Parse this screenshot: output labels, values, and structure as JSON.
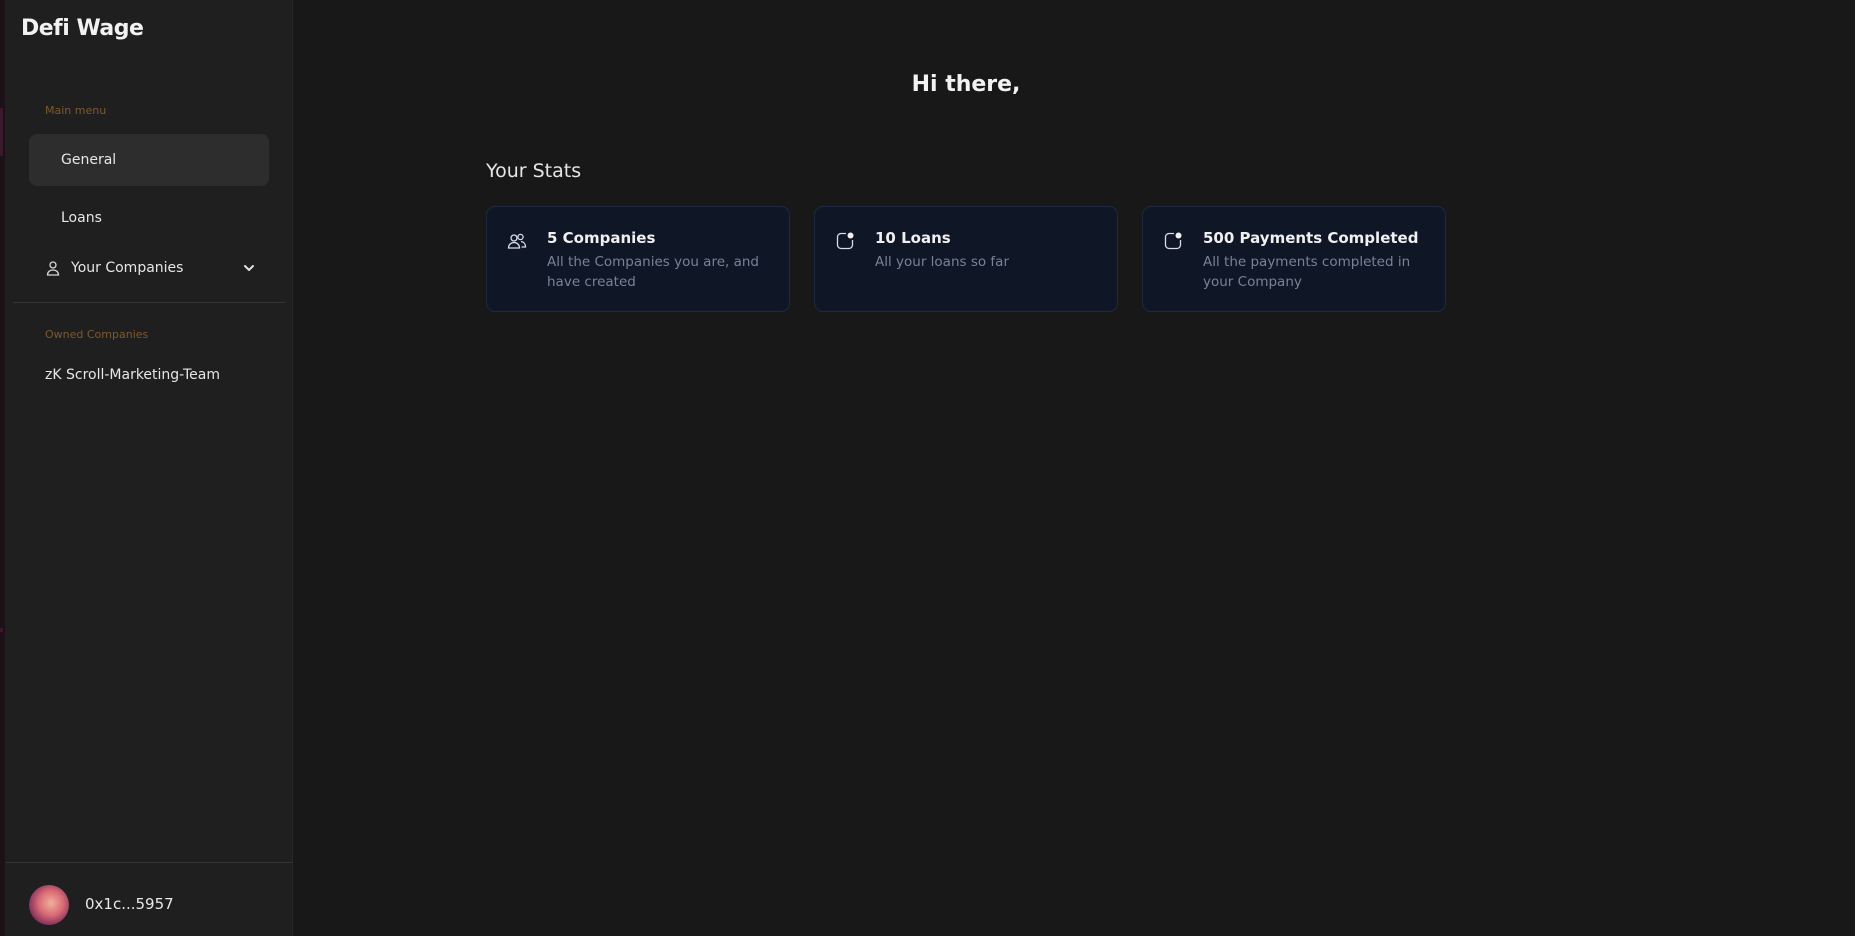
{
  "app": {
    "brand": "Defi Wage"
  },
  "sidebar": {
    "main_menu_label": "Main menu",
    "items": [
      {
        "label": "General",
        "active": true
      },
      {
        "label": "Loans",
        "active": false
      }
    ],
    "companies_dropdown": {
      "label": "Your Companies",
      "icon": "user-icon",
      "chevron": "chevron-down-icon"
    },
    "owned_label": "Owned Companies",
    "owned_companies": [
      {
        "label": "zK Scroll-Marketing-Team"
      }
    ],
    "footer": {
      "wallet_address": "0x1c...5957"
    }
  },
  "main": {
    "greeting": "Hi there,",
    "stats_title": "Your Stats",
    "stats": [
      {
        "icon": "users-icon",
        "title": "5 Companies",
        "description": "All the Companies you are, and have created"
      },
      {
        "icon": "notification-icon",
        "title": "10 Loans",
        "description": "All your loans so far"
      },
      {
        "icon": "notification-icon",
        "title": "500 Payments Completed",
        "description": "All the payments completed in your Company"
      }
    ]
  },
  "colors": {
    "background": "#181818",
    "sidebar": "#1f1f1f",
    "active_item": "#2d2d2d",
    "section_label": "#7a5a2e",
    "card_background": "#0f1626",
    "card_border": "#1f2a40",
    "muted_text": "#7a8195"
  }
}
